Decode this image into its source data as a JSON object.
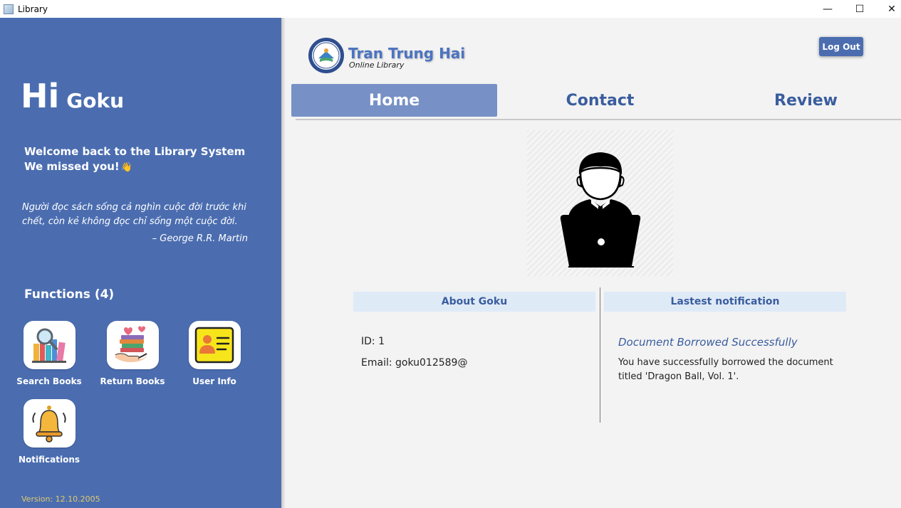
{
  "window": {
    "title": "Library",
    "minimize_glyph": "—",
    "maximize_glyph": "☐",
    "close_glyph": "✕"
  },
  "sidebar": {
    "greeting": "Hi",
    "user_name": "Goku",
    "welcome_line1": "Welcome back to the Library System",
    "welcome_line2": "We missed you!",
    "wave_emoji": "👋",
    "quote": "Người đọc sách sống cả nghìn cuộc đời trước khi chết, còn kẻ không đọc chỉ sống một cuộc đời.",
    "quote_author": "– George R.R. Martin",
    "functions_title": "Functions (4)",
    "functions": [
      {
        "label": "Search Books",
        "icon": "search-books-icon"
      },
      {
        "label": "Return Books",
        "icon": "return-books-icon"
      },
      {
        "label": "User Info",
        "icon": "user-info-icon"
      },
      {
        "label": "Notifications",
        "icon": "bell-icon"
      }
    ],
    "version": "Version: 12.10.2005"
  },
  "header": {
    "brand_name": "Tran Trung Hai",
    "brand_sub": "Online Library",
    "logout_label": "Log Out"
  },
  "tabs": [
    {
      "label": "Home",
      "active": true
    },
    {
      "label": "Contact",
      "active": false
    },
    {
      "label": "Review",
      "active": false
    }
  ],
  "about": {
    "title": "About Goku",
    "id_line": "ID: 1",
    "email_line": "Email: goku012589@"
  },
  "notification": {
    "title": "Lastest notification",
    "subject": "Document Borrowed Successfully",
    "body": "You have successfully borrowed the document titled 'Dragon Ball, Vol. 1'."
  },
  "colors": {
    "sidebar_bg": "#4b6db0",
    "accent": "#3a5d9e",
    "active_tab": "#7790c6",
    "panel_head": "#dfeaf7"
  }
}
